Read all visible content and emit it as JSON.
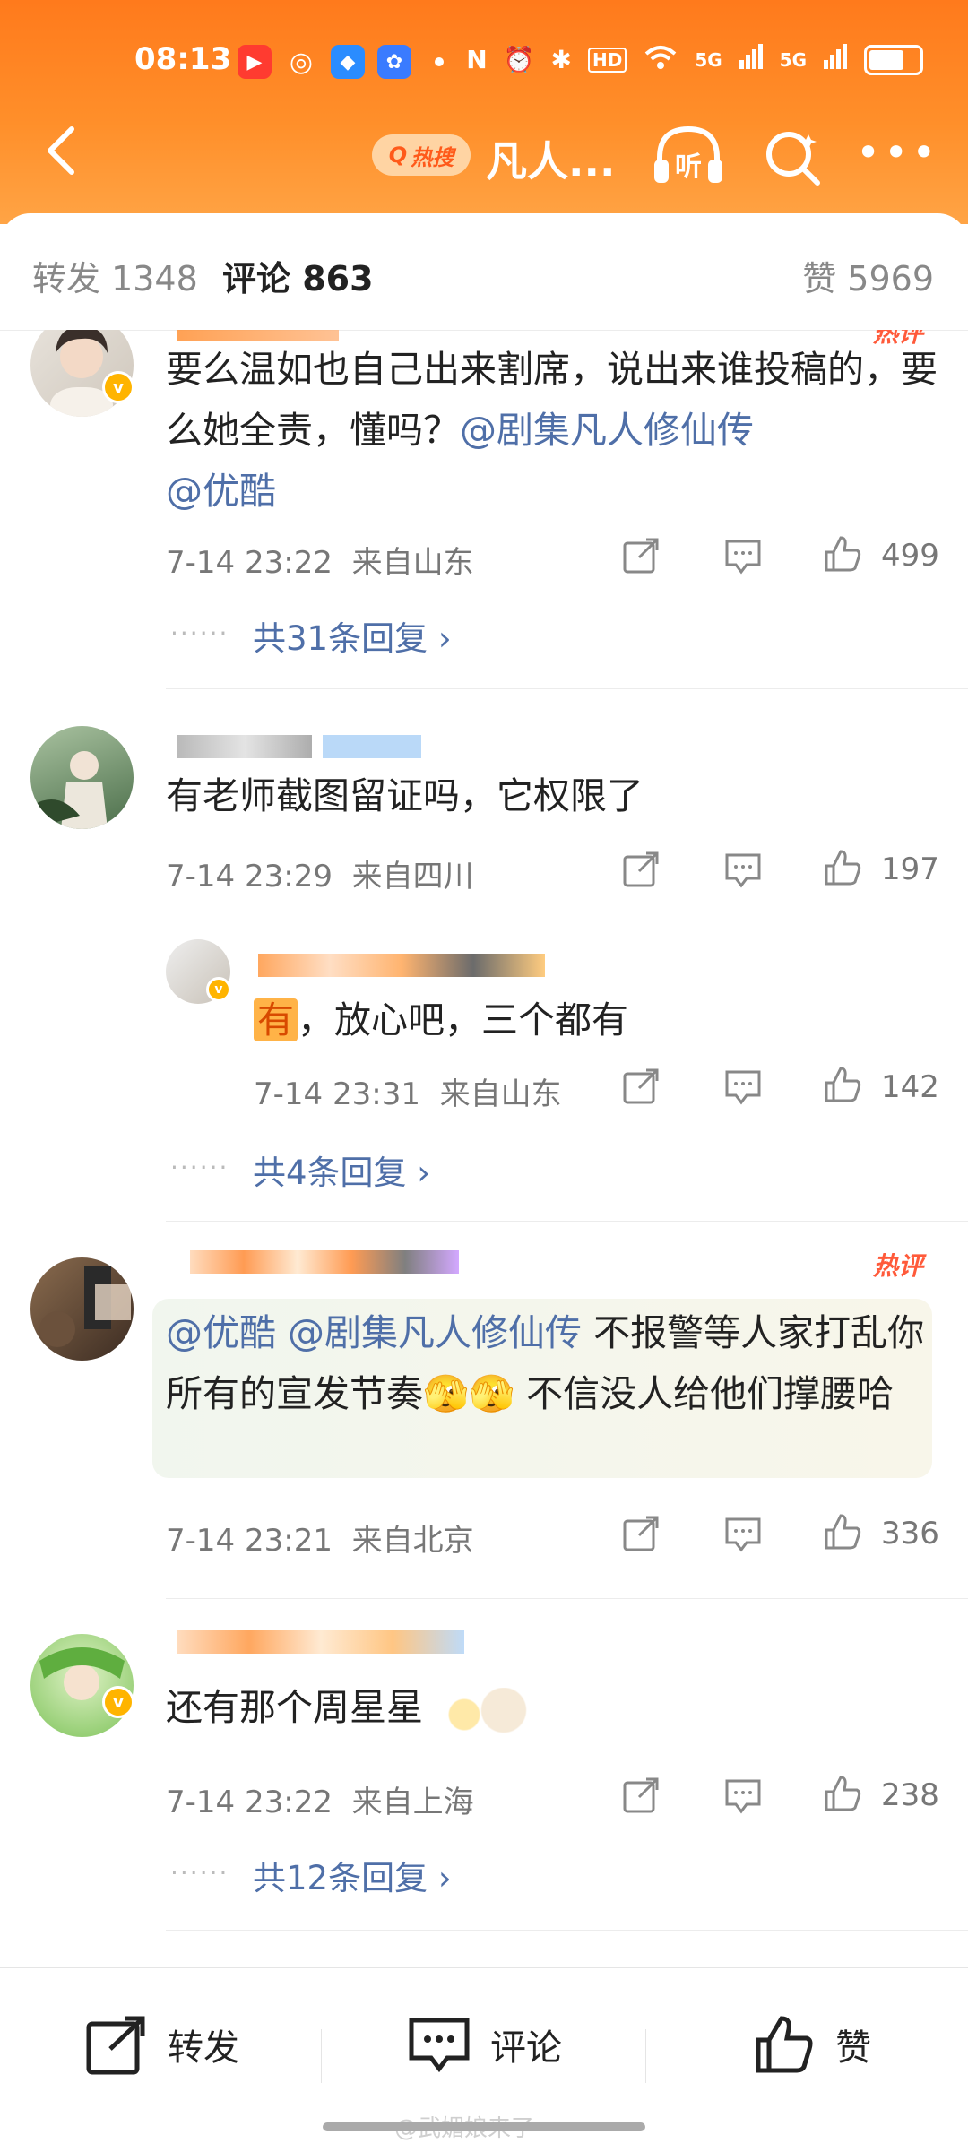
{
  "status_bar": {
    "time": "08:13",
    "network_labels": [
      "5G",
      "5G"
    ],
    "battery_level": 0.8
  },
  "nav": {
    "hot_label": "热搜",
    "title": "凡人...",
    "listen_label": "听"
  },
  "tabs": {
    "repost": "转发 1348",
    "comments": "评论 863",
    "likes": "赞 5969"
  },
  "hot_badge": "热评",
  "comments": [
    {
      "text_plain": "要么温如也自己出来割席，说出来谁投稿的，要么她全责，懂吗？",
      "mentions": [
        "@剧集凡人修仙传",
        "@优酷"
      ],
      "time": "7-14 23:22",
      "location": "来自山东",
      "likes": "499",
      "more_replies": "共31条回复 ›"
    },
    {
      "text_plain": "有老师截图留证吗，它权限了",
      "time": "7-14 23:29",
      "location": "来自四川",
      "likes": "197",
      "reply": {
        "tag": "有",
        "text": "，放心吧，三个都有",
        "time": "7-14 23:31",
        "location": "来自山东",
        "likes": "142"
      },
      "more_replies": "共4条回复 ›"
    },
    {
      "mentions": [
        "@优酷",
        "@剧集凡人修仙传"
      ],
      "text_a": " 不报警等人家打乱你所有的宣发节奏",
      "text_b": " 不信没人给他们撑腰哈",
      "time": "7-14 23:21",
      "location": "来自北京",
      "likes": "336"
    },
    {
      "text_plain": "还有那个周星星",
      "time": "7-14 23:22",
      "location": "来自上海",
      "likes": "238",
      "more_replies": "共12条回复 ›"
    }
  ],
  "bottom_bar": {
    "repost": "转发",
    "comment": "评论",
    "like": "赞",
    "watermark": "@武媚娘来了"
  },
  "colors": {
    "header_orange": "#ff7a1c",
    "link_blue": "#4f6fa8",
    "hot_red": "#ff5a3a"
  }
}
